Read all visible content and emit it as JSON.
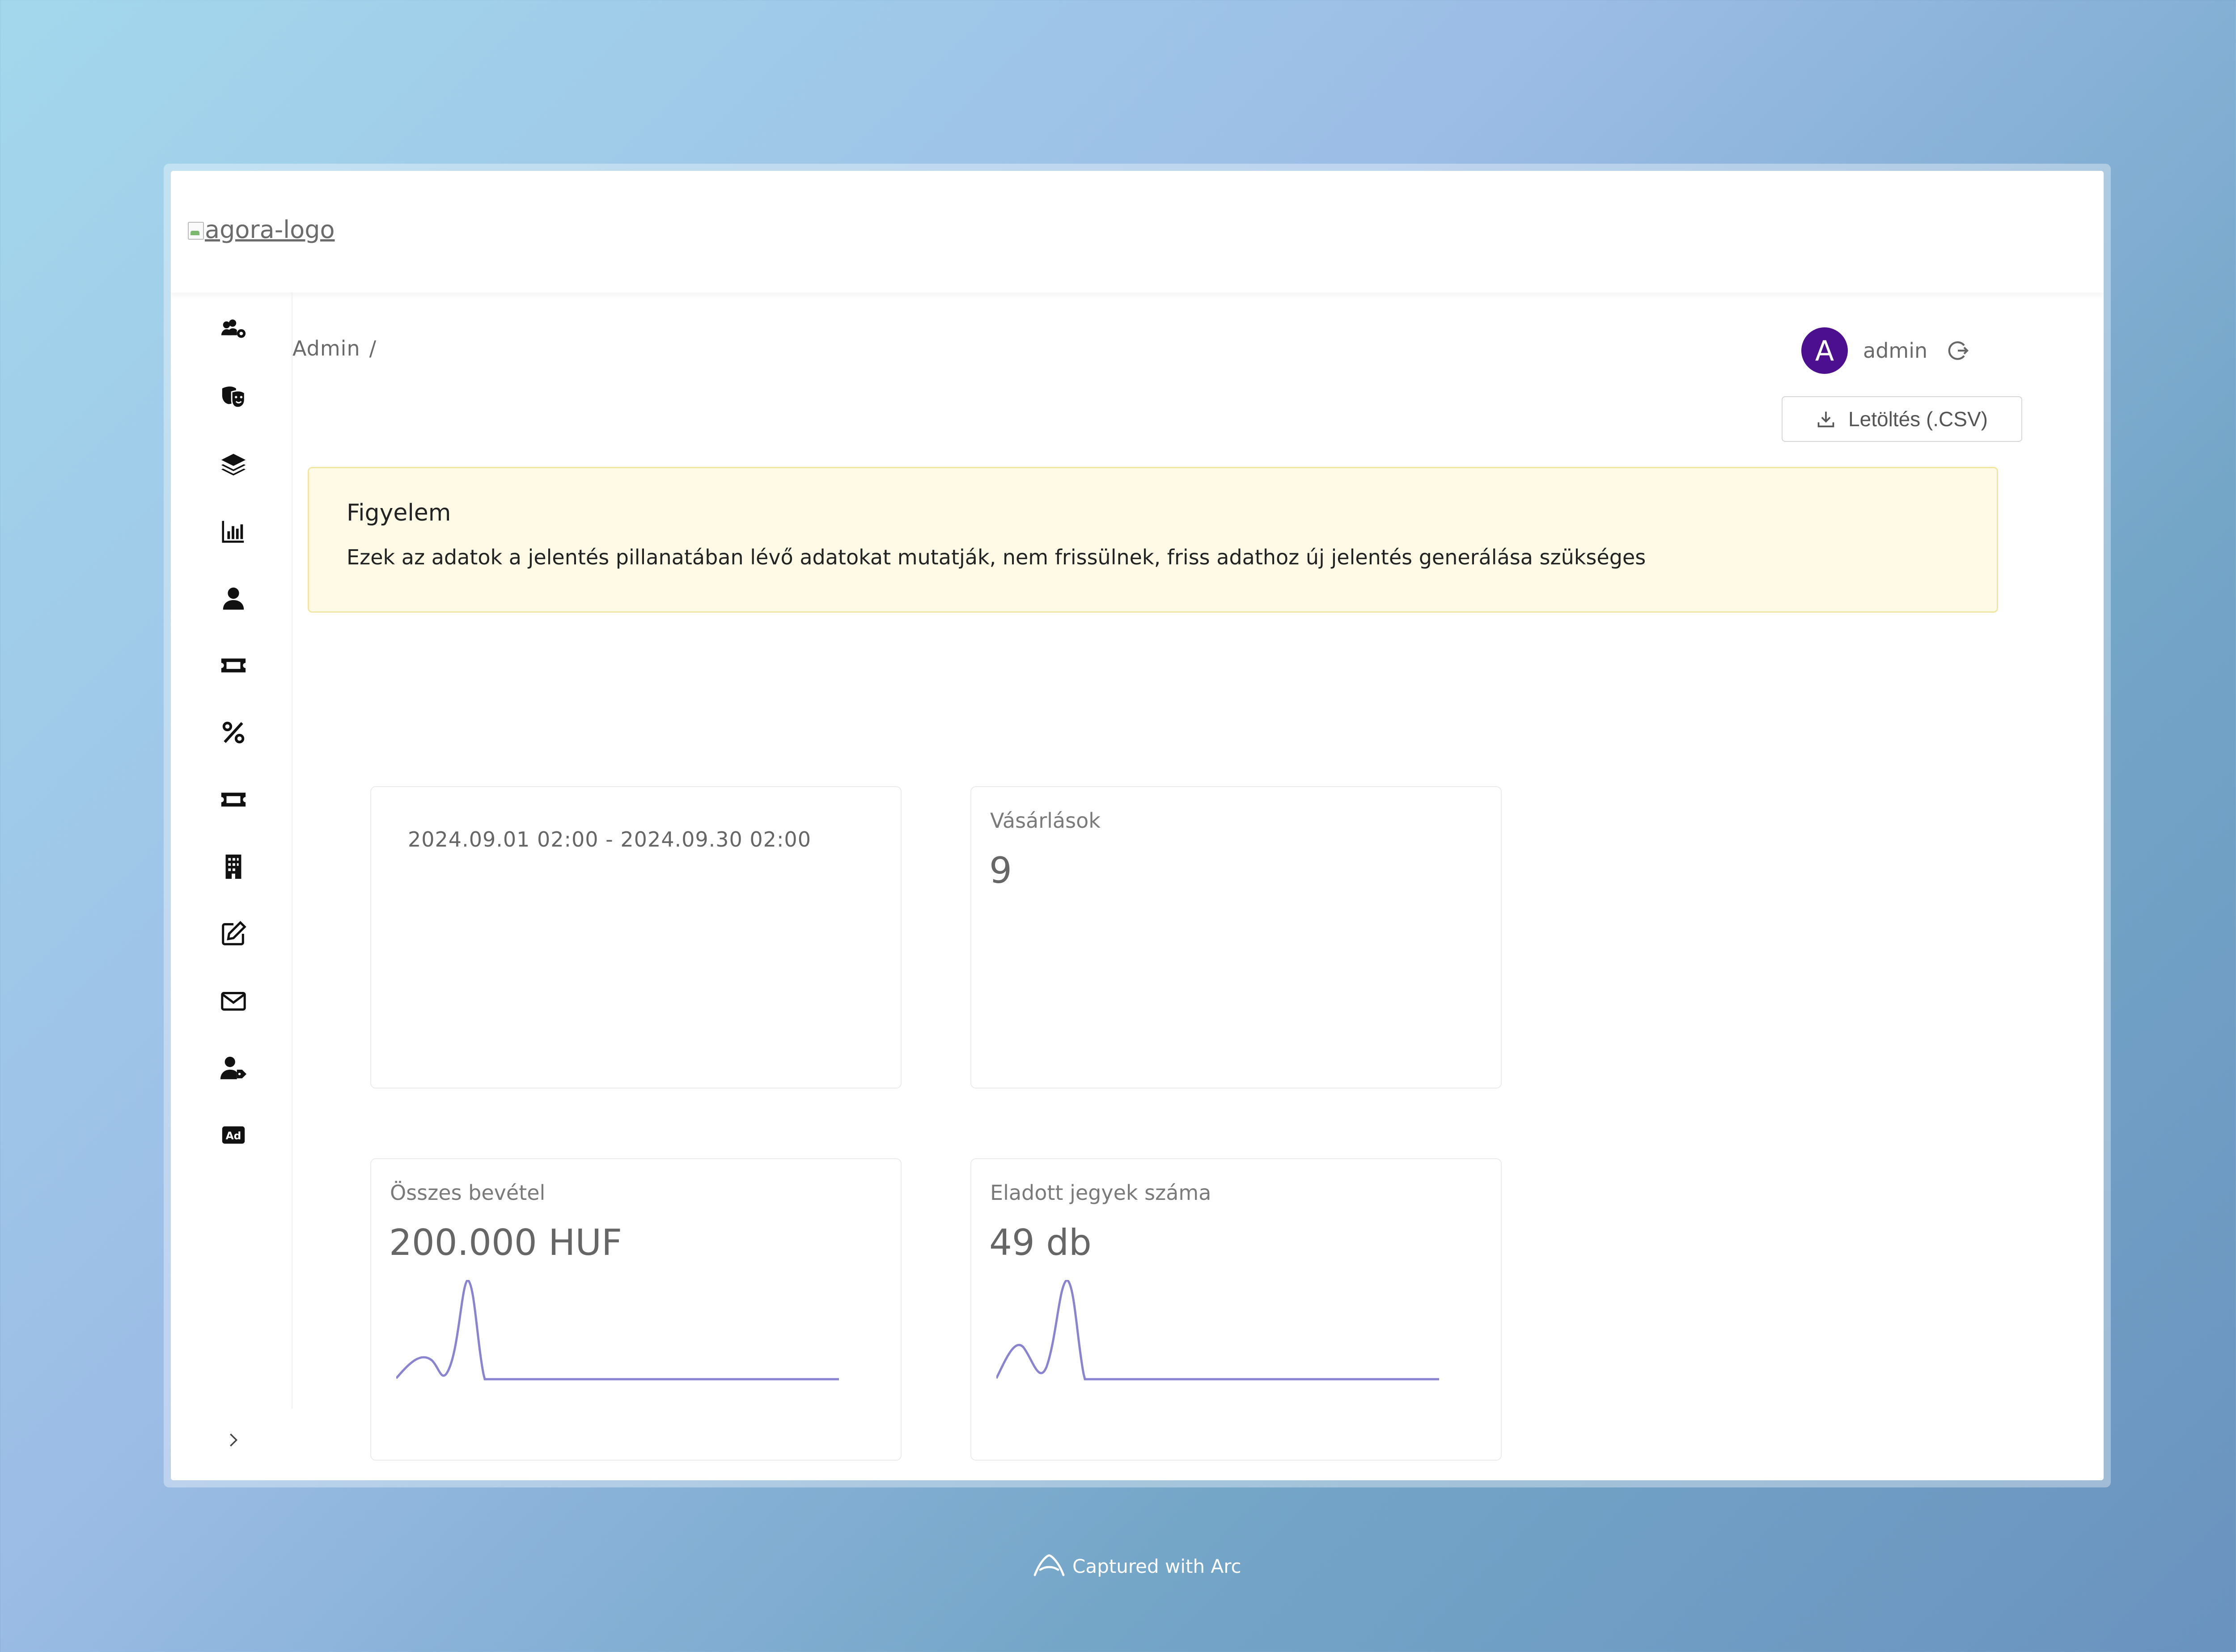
{
  "header": {
    "logo_alt": "agora-logo"
  },
  "sidebar": {
    "items": [
      {
        "icon": "users-cog-icon"
      },
      {
        "icon": "theater-masks-icon"
      },
      {
        "icon": "layers-icon"
      },
      {
        "icon": "bar-chart-icon"
      },
      {
        "icon": "user-icon"
      },
      {
        "icon": "ticket-icon"
      },
      {
        "icon": "percent-icon"
      },
      {
        "icon": "ticket-alt-icon"
      },
      {
        "icon": "building-icon"
      },
      {
        "icon": "edit-icon"
      },
      {
        "icon": "envelope-icon"
      },
      {
        "icon": "user-tag-icon"
      },
      {
        "icon": "ad-icon"
      }
    ],
    "collapse_icon": "chevron-right-icon"
  },
  "breadcrumb": {
    "root": "Admin",
    "separator": "/"
  },
  "user": {
    "avatar_letter": "A",
    "name": "admin"
  },
  "toolbar": {
    "csv_label": "Letöltés (.CSV)"
  },
  "alert": {
    "title": "Figyelem",
    "text": "Ezek az adatok a jelentés pillanatában lévő adatokat mutatják, nem frissülnek, friss adathoz új jelentés generálása szükséges"
  },
  "cards": {
    "period": {
      "range": "2024.09.01 02:00 - 2024.09.30 02:00"
    },
    "purchases": {
      "label": "Vásárlások",
      "value": "9"
    },
    "revenue": {
      "label": "Összes bevétel",
      "value": "200.000 HUF"
    },
    "tickets": {
      "label": "Eladott jegyek száma",
      "value": "49 db"
    }
  },
  "colors": {
    "accent": "#4b0f8f",
    "spark": "#8a83d2",
    "alert_bg": "#fefae6",
    "alert_border": "#f2e6a3"
  },
  "footer": {
    "arc_text": "Captured with Arc"
  }
}
